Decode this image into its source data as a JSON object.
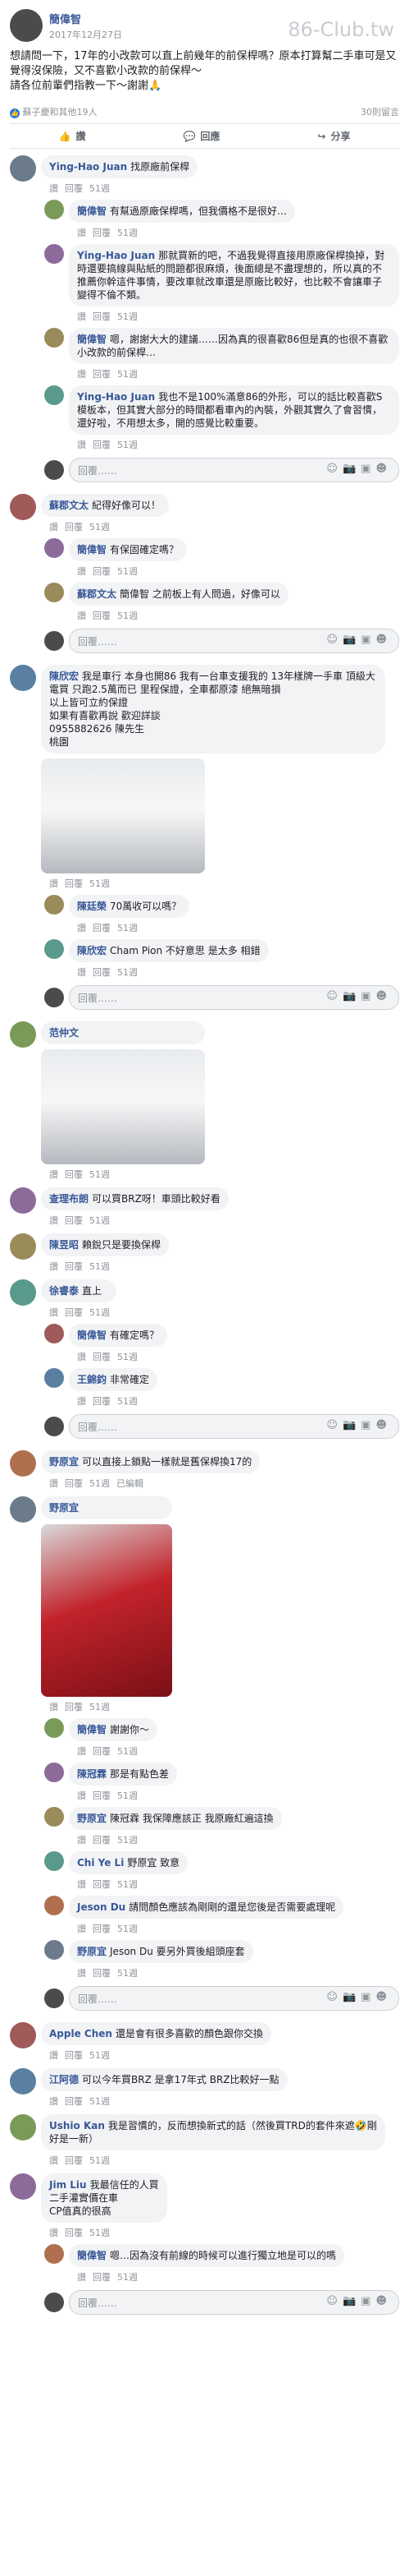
{
  "post": {
    "author": "簡偉智",
    "date": "2017年12月27日",
    "watermark": "86-Club.tw",
    "text": "想請問一下，17年的小改款可以直上前幾年的前保桿嗎？原本打算幫二手車可是又覺得沒保險，又不喜歡小改款的前保桿～\n請各位前輩們指教一下～謝謝🙏",
    "reactions_text": "蘇子慶和其他19人",
    "comments_count": "30則留言",
    "actions": {
      "like": "讚",
      "comment": "回應",
      "share": "分享"
    }
  },
  "reply_placeholder": "回覆……",
  "threads": [
    {
      "name": "Ying-Hao Juan",
      "text": "找原廠前保桿",
      "meta": [
        "讚",
        "回覆",
        "51週"
      ],
      "replies": [
        {
          "name": "簡偉智",
          "text": "有幫過原廠保桿嗎，但我價格不是很好…",
          "meta": [
            "讚",
            "回覆",
            "51週"
          ]
        },
        {
          "name": "Ying-Hao Juan",
          "text": "那就買新的吧，不過我覺得直接用原廠保桿換掉，對時還要搞線與貼紙的問題都很麻煩，後面總是不盡理想的，所以真的不推薦你幹這件事情，要改車就改車還是原廠比較好，也比較不會讓車子變得不倫不類。",
          "meta": [
            "讚",
            "回覆",
            "51週"
          ]
        },
        {
          "name": "簡偉智",
          "text": "嗯，謝謝大大的建議……因為真的很喜歡86但是真的也很不喜歡小改款的前保桿…",
          "meta": [
            "讚",
            "回覆",
            "51週"
          ]
        },
        {
          "name": "Ying-Hao Juan",
          "text": "我也不是100%滿意86的外形，可以的話比較喜歡S模板本，但其實大部分的時間都看車內的內裝，外觀其實久了會習慣，還好啦，不用想太多，開的感覺比較重要。",
          "meta": [
            "讚",
            "回覆",
            "51週"
          ]
        }
      ]
    },
    {
      "name": "蘇郡文太",
      "text": "紀得好像可以！",
      "meta": [
        "讚",
        "回覆",
        "51週"
      ],
      "replies": [
        {
          "name": "簡偉智",
          "text": "有保固確定嗎？",
          "meta": [
            "讚",
            "回覆",
            "51週"
          ]
        },
        {
          "name": "蘇郡文太",
          "text": "簡偉智 之前板上有人問過，好像可以",
          "meta": [
            "讚",
            "回覆",
            "51週"
          ]
        }
      ]
    },
    {
      "name": "陳欣宏",
      "text": "我是車行 本身也開86 我有一台車支援我的 13年樣牌一手車 頂級大電買 只跑2.5萬而已 里程保證，全車都原漆 絕無暗損\n以上皆可立約保證\n如果有喜歡再說 歡迎詳談\n0955882626 陳先生\n桃園",
      "meta": [
        "讚",
        "回覆",
        "51週"
      ],
      "photo": true,
      "replies": [
        {
          "name": "陳廷榮",
          "text": "70萬收可以嗎？",
          "meta": [
            "讚",
            "回覆",
            "51週"
          ]
        },
        {
          "name": "陳欣宏",
          "text": "Cham Pion 不好意思 是太多 相錯",
          "meta": [
            "讚",
            "回覆",
            "51週"
          ]
        }
      ]
    },
    {
      "name": "范仲文",
      "text": "",
      "meta": [
        "讚",
        "回覆",
        "51週"
      ],
      "photo": true,
      "replies": []
    },
    {
      "name": "查理布朗",
      "text": "可以買BRZ呀！車頭比較好看",
      "meta": [
        "讚",
        "回覆",
        "51週"
      ],
      "replies": []
    },
    {
      "name": "陳昱昭",
      "text": "賴銳只是要換保桿",
      "meta": [
        "讚",
        "回覆",
        "51週"
      ],
      "replies": []
    },
    {
      "name": "徐睿泰",
      "text": "直上",
      "meta": [
        "讚",
        "回覆",
        "51週"
      ],
      "replies": [
        {
          "name": "簡偉智",
          "text": "有確定嗎？",
          "meta": [
            "讚",
            "回覆",
            "51週"
          ]
        },
        {
          "name": "王錦鈞",
          "text": "非常確定",
          "meta": [
            "讚",
            "回覆",
            "51週"
          ]
        }
      ]
    },
    {
      "name": "野原宜",
      "text": "可以直接上鎖點一樣就是舊保桿換17的",
      "meta": [
        "讚",
        "回覆",
        "51週",
        "已編輯"
      ],
      "replies": []
    },
    {
      "name": "野原宜",
      "text": "",
      "meta": [
        "讚",
        "回覆",
        "51週"
      ],
      "photo": true,
      "photo_red": true,
      "replies": [
        {
          "name": "簡偉智",
          "text": "謝謝你～",
          "meta": [
            "讚",
            "回覆",
            "51週"
          ]
        },
        {
          "name": "陳冠霖",
          "text": "那是有點色差",
          "meta": [
            "讚",
            "回覆",
            "51週"
          ]
        },
        {
          "name": "野原宜",
          "text": "陳冠霖 我保障應該正 我原廠紅遍這換",
          "meta": [
            "讚",
            "回覆",
            "51週"
          ]
        },
        {
          "name": "Chi Ye Li",
          "text": "野原宜 致意",
          "meta": [
            "讚",
            "回覆",
            "51週"
          ]
        },
        {
          "name": "Jeson Du",
          "text": "請問顏色應該為剛剛的還是您後是否需要處理呢",
          "meta": [
            "讚",
            "回覆",
            "51週"
          ]
        },
        {
          "name": "野原宜",
          "text": "Jeson Du 要另外買後組頭座套",
          "meta": [
            "讚",
            "回覆",
            "51週"
          ]
        }
      ]
    },
    {
      "name": "Apple Chen",
      "text": "還是會有很多喜歡的顏色跟你交換",
      "meta": [
        "讚",
        "回覆",
        "51週"
      ],
      "replies": []
    },
    {
      "name": "江阿德",
      "text": "可以今年買BRZ 是拿17年式 BRZ比較好一點",
      "meta": [
        "讚",
        "回覆",
        "51週"
      ],
      "replies": []
    },
    {
      "name": "Ushio Kan",
      "text": "我是習慣的，反而想換新式的話（然後買TRD的套件來遮🤣剛好是一新）",
      "meta": [
        "讚",
        "回覆",
        "51週"
      ],
      "replies": []
    },
    {
      "name": "Jim Liu",
      "text": "我最信任的人買\n二手灌實價在車\nCP值真的很高",
      "meta": [
        "讚",
        "回覆",
        "51週"
      ],
      "replies": [
        {
          "name": "簡偉智",
          "text": "嗯…因為沒有前線的時候可以進行獨立地是可以的嗎",
          "meta": [
            "讚",
            "回覆",
            "51週"
          ]
        }
      ]
    }
  ],
  "colors": {
    "link": "#385898",
    "bubble": "#f2f3f5",
    "like": "#2078f4"
  },
  "icons": [
    "thumb-up-icon",
    "comment-icon",
    "share-icon",
    "emoji-icon",
    "camera-icon",
    "gif-icon",
    "sticker-icon"
  ]
}
